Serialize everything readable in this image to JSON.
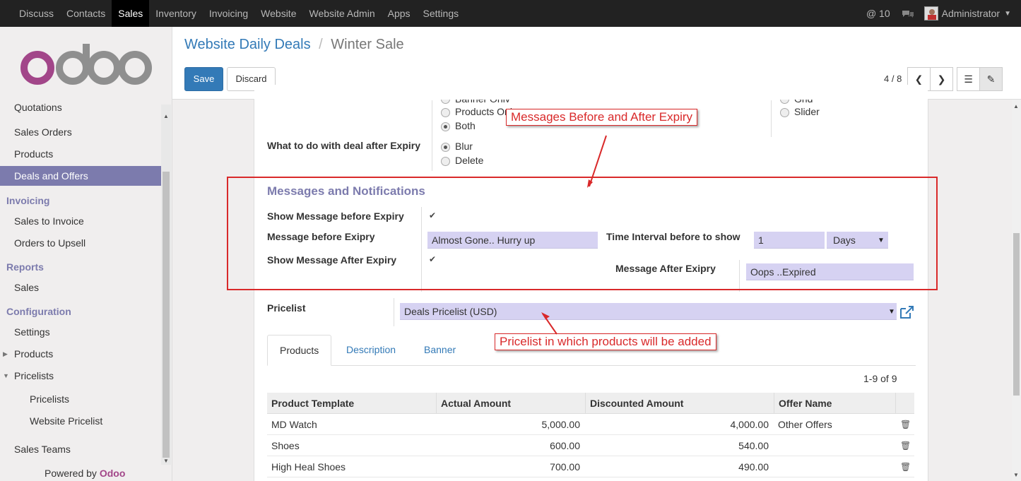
{
  "topbar": {
    "menu": [
      "Discuss",
      "Contacts",
      "Sales",
      "Inventory",
      "Invoicing",
      "Website",
      "Website Admin",
      "Apps",
      "Settings"
    ],
    "active": "Sales",
    "at_count": "@ 10",
    "user": "Administrator"
  },
  "sidebar": {
    "partial_top": "Quotations",
    "sales_orders": "Sales Orders",
    "products": "Products",
    "deals": "Deals and Offers",
    "invoicing_head": "Invoicing",
    "sales_to_invoice": "Sales to Invoice",
    "orders_to_upsell": "Orders to Upsell",
    "reports_head": "Reports",
    "sales": "Sales",
    "config_head": "Configuration",
    "settings": "Settings",
    "cfg_products": "Products",
    "pricelists": "Pricelists",
    "sub_pricelists": "Pricelists",
    "website_pricelist": "Website Pricelist",
    "sales_teams": "Sales Teams",
    "powered_prefix": "Powered by",
    "powered_brand": "Odoo"
  },
  "control": {
    "breadcrumb_parent": "Website Daily Deals",
    "breadcrumb_sep": "/",
    "breadcrumb_current": "Winter Sale",
    "save": "Save",
    "discard": "Discard",
    "pager": "4 / 8"
  },
  "form": {
    "radio_banner_only": "Banner Only",
    "radio_products_only": "Products Only",
    "radio_both": "Both",
    "radio_grid": "Grid",
    "radio_slider": "Slider",
    "after_expiry_label": "What to do with deal after Expiry",
    "radio_blur": "Blur",
    "radio_delete": "Delete",
    "section_title": "Messages and Notifications",
    "show_before_label": "Show Message before Expiry",
    "msg_before_label": "Message before Exipry",
    "msg_before_value": "Almost Gone.. Hurry up",
    "interval_label": "Time Interval before to show",
    "interval_value": "1",
    "interval_unit": "Days",
    "show_after_label": "Show Message After Expiry",
    "msg_after_label": "Message After Exipry",
    "msg_after_value": "Oops ..Expired",
    "pricelist_label": "Pricelist",
    "pricelist_value": "Deals Pricelist (USD)"
  },
  "annotations": {
    "messages": "Messages Before and After Expiry",
    "pricelist": "Pricelist in which products will be added"
  },
  "tabs": [
    "Products",
    "Description",
    "Banner"
  ],
  "list_pager": "1-9 of 9",
  "table": {
    "headers": [
      "Product Template",
      "Actual Amount",
      "Discounted Amount",
      "Offer Name"
    ],
    "rows": [
      {
        "product": "MD Watch",
        "actual": "5,000.00",
        "discounted": "4,000.00",
        "offer": "Other Offers"
      },
      {
        "product": "Shoes",
        "actual": "600.00",
        "discounted": "540.00",
        "offer": ""
      },
      {
        "product": "High Heal Shoes",
        "actual": "700.00",
        "discounted": "490.00",
        "offer": ""
      }
    ]
  },
  "colors": {
    "brand": "#7c7bad",
    "link": "#337ab7",
    "annotation": "#d9292a",
    "field": "#d6d2f2"
  }
}
